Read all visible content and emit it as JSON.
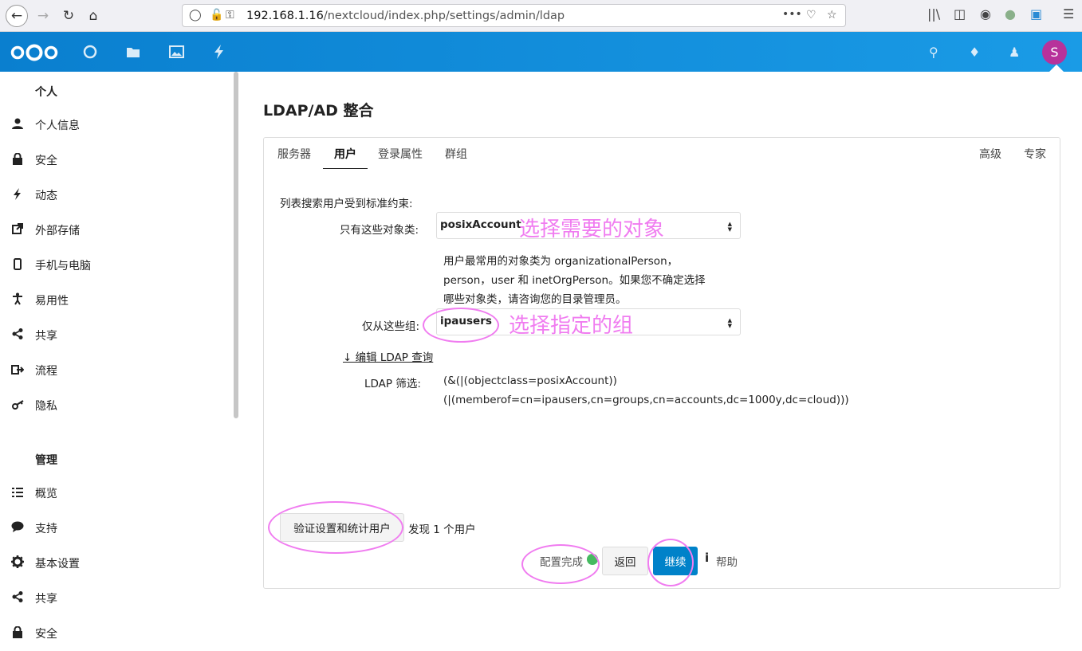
{
  "browser": {
    "url_host": "192.168.1.16",
    "url_path": "/nextcloud/index.php/settings/admin/ldap",
    "menu_dots": "•••"
  },
  "header": {
    "avatar_letter": "S"
  },
  "sidebar": {
    "personal_title": "个人",
    "personal_items": [
      {
        "label": "个人信息",
        "icon": "person-icon"
      },
      {
        "label": "安全",
        "icon": "lock-icon"
      },
      {
        "label": "动态",
        "icon": "lightning-icon"
      },
      {
        "label": "外部存储",
        "icon": "external-link-icon"
      },
      {
        "label": "手机与电脑",
        "icon": "phone-icon"
      },
      {
        "label": "易用性",
        "icon": "accessibility-icon"
      },
      {
        "label": "共享",
        "icon": "share-icon"
      },
      {
        "label": "流程",
        "icon": "flow-icon"
      },
      {
        "label": "隐私",
        "icon": "key-icon"
      }
    ],
    "admin_title": "管理",
    "admin_items": [
      {
        "label": "概览",
        "icon": "list-icon"
      },
      {
        "label": "支持",
        "icon": "comment-icon"
      },
      {
        "label": "基本设置",
        "icon": "gear-icon"
      },
      {
        "label": "共享",
        "icon": "share-icon"
      },
      {
        "label": "安全",
        "icon": "lock-icon"
      }
    ]
  },
  "main": {
    "title": "LDAP/AD 整合",
    "tabs": [
      "服务器",
      "用户",
      "登录属性",
      "群组"
    ],
    "tabs_right": [
      "高级",
      "专家"
    ],
    "intro": "列表搜索用户受到标准约束:",
    "objectclass_label": "只有这些对象类:",
    "objectclass_value": "posixAccount",
    "objectclass_annotation": "选择需要的对象",
    "help_lines": [
      "用户最常用的对象类为 organizationalPerson，",
      "person，user 和 inetOrgPerson。如果您不确定选择",
      "哪些对象类，请咨询您的目录管理员。"
    ],
    "group_label": "仅从这些组:",
    "group_value": "ipausers",
    "group_annotation": "选择指定的组",
    "edit_link": "↓ 编辑 LDAP 查询",
    "filter_label": "LDAP 筛选:",
    "filter_lines": [
      "(&(|(objectclass=posixAccount))",
      "(|(memberof=cn=ipausers,cn=groups,cn=accounts,dc=1000y,dc=cloud)))"
    ],
    "verify_button": "验证设置和统计用户",
    "found_text": "发现 1 个用户",
    "config_status": "配置完成",
    "back_button": "返回",
    "continue_button": "继续",
    "help_icon": "i",
    "help_label": "帮助"
  }
}
